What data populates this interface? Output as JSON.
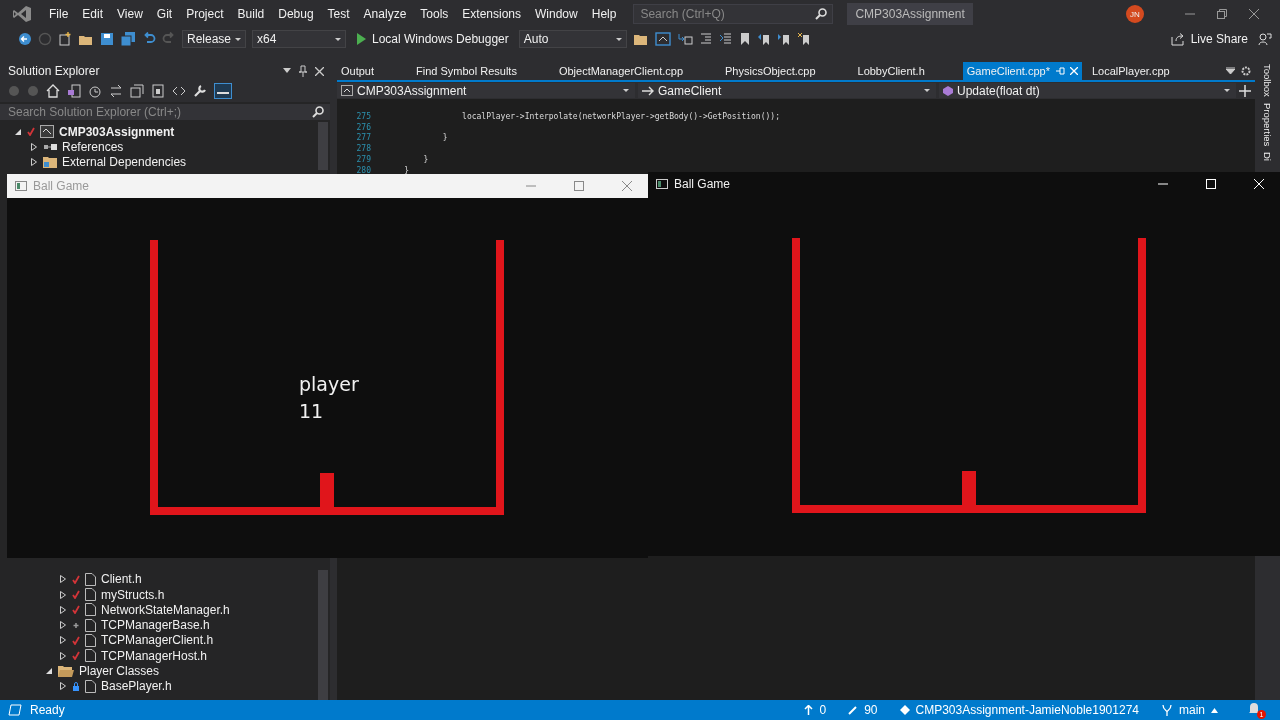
{
  "menu": [
    "File",
    "Edit",
    "View",
    "Git",
    "Project",
    "Build",
    "Debug",
    "Test",
    "Analyze",
    "Tools",
    "Extensions",
    "Window",
    "Help"
  ],
  "search": {
    "placeholder": "Search (Ctrl+Q)"
  },
  "solution_title": "CMP303Assignment",
  "user_initials": "JN",
  "toolbar": {
    "configuration": "Release",
    "platform": "x64",
    "debugger": "Local Windows Debugger",
    "mode": "Auto",
    "live_share": "Live Share"
  },
  "solution_explorer": {
    "title": "Solution Explorer",
    "search_placeholder": "Search Solution Explorer (Ctrl+;)",
    "tree": [
      {
        "label": "CMP303Assignment",
        "kind": "project",
        "modified": true,
        "expanded": true,
        "children": [
          {
            "label": "References",
            "kind": "references",
            "expanded": false
          },
          {
            "label": "External Dependencies",
            "kind": "folder",
            "expanded": false
          }
        ]
      }
    ],
    "networking_files": [
      {
        "label": "Client.h",
        "kind": "modified"
      },
      {
        "label": "myStructs.h",
        "kind": "modified"
      },
      {
        "label": "NetworkStateManager.h",
        "kind": "modified"
      },
      {
        "label": "TCPManagerBase.h",
        "kind": "added"
      },
      {
        "label": "TCPManagerClient.h",
        "kind": "modified"
      },
      {
        "label": "TCPManagerHost.h",
        "kind": "modified"
      }
    ],
    "folders": [
      {
        "label": "Player Classes",
        "expanded": true,
        "children": [
          {
            "label": "BasePlayer.h",
            "kind": "locked"
          }
        ]
      }
    ]
  },
  "editor_tabs": [
    {
      "label": "Output",
      "selected": false
    },
    {
      "label": "Find Symbol Results",
      "selected": false
    },
    {
      "label": "ObjectManagerClient.cpp",
      "selected": false
    },
    {
      "label": "PhysicsObject.cpp",
      "selected": false
    },
    {
      "label": "LobbyClient.h",
      "selected": false
    },
    {
      "label": "GameClient.cpp*",
      "selected": true
    },
    {
      "label": "LocalPlayer.cpp",
      "selected": false
    }
  ],
  "navigation": {
    "project": "CMP303Assignment",
    "type": "GameClient",
    "member": "Update(float dt)"
  },
  "code_lines": [
    {
      "number": "275",
      "text": "                localPlayer->Interpolate(networkPlayer->getBody()->GetPosition());"
    },
    {
      "number": "276"
    },
    {
      "number": "277",
      "text": "            }"
    },
    {
      "number": "278"
    },
    {
      "number": "279",
      "text": "        }"
    },
    {
      "number": "280",
      "text": "    }"
    }
  ],
  "side_tabs": [
    "Toolbox",
    "Properties",
    "Di"
  ],
  "game_windows": [
    {
      "title": "Ball Game",
      "active": false,
      "label_lines": [
        "player",
        "11"
      ]
    },
    {
      "title": "Ball Game",
      "active": true
    }
  ],
  "status_bar": {
    "state": "Ready",
    "pushes": "0",
    "changes": "90",
    "repository": "CMP303Assignment-JamieNoble1901274",
    "branch": "main",
    "notifications": "1"
  }
}
